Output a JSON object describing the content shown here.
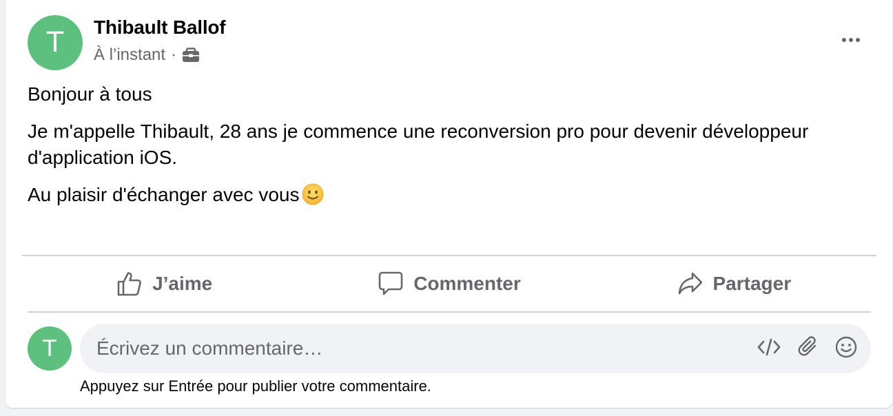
{
  "post": {
    "author_initial": "T",
    "author_name": "Thibault Ballof",
    "timestamp": "À l’instant",
    "separator": "·",
    "audience_icon": "briefcase-icon",
    "paragraphs": [
      "Bonjour à tous",
      "Je m'appelle Thibault, 28 ans je commence une reconversion pro pour devenir développeur d'application iOS.",
      "Au plaisir d'échanger avec vous"
    ],
    "emoji": "slightly-smiling-face"
  },
  "actions": {
    "like_label": "J’aime",
    "comment_label": "Commenter",
    "share_label": "Partager"
  },
  "comment": {
    "avatar_initial": "T",
    "placeholder": "Écrivez un commentaire…",
    "value": "",
    "hint": "Appuyez sur Entrée pour publier votre commentaire.",
    "tools": [
      "code-icon",
      "paperclip-icon",
      "emoji-icon"
    ]
  },
  "colors": {
    "avatar": "#5ec07e",
    "muted_text": "#65676b",
    "text": "#050505",
    "input_bg": "#f0f2f5",
    "divider": "#ced0d4"
  }
}
